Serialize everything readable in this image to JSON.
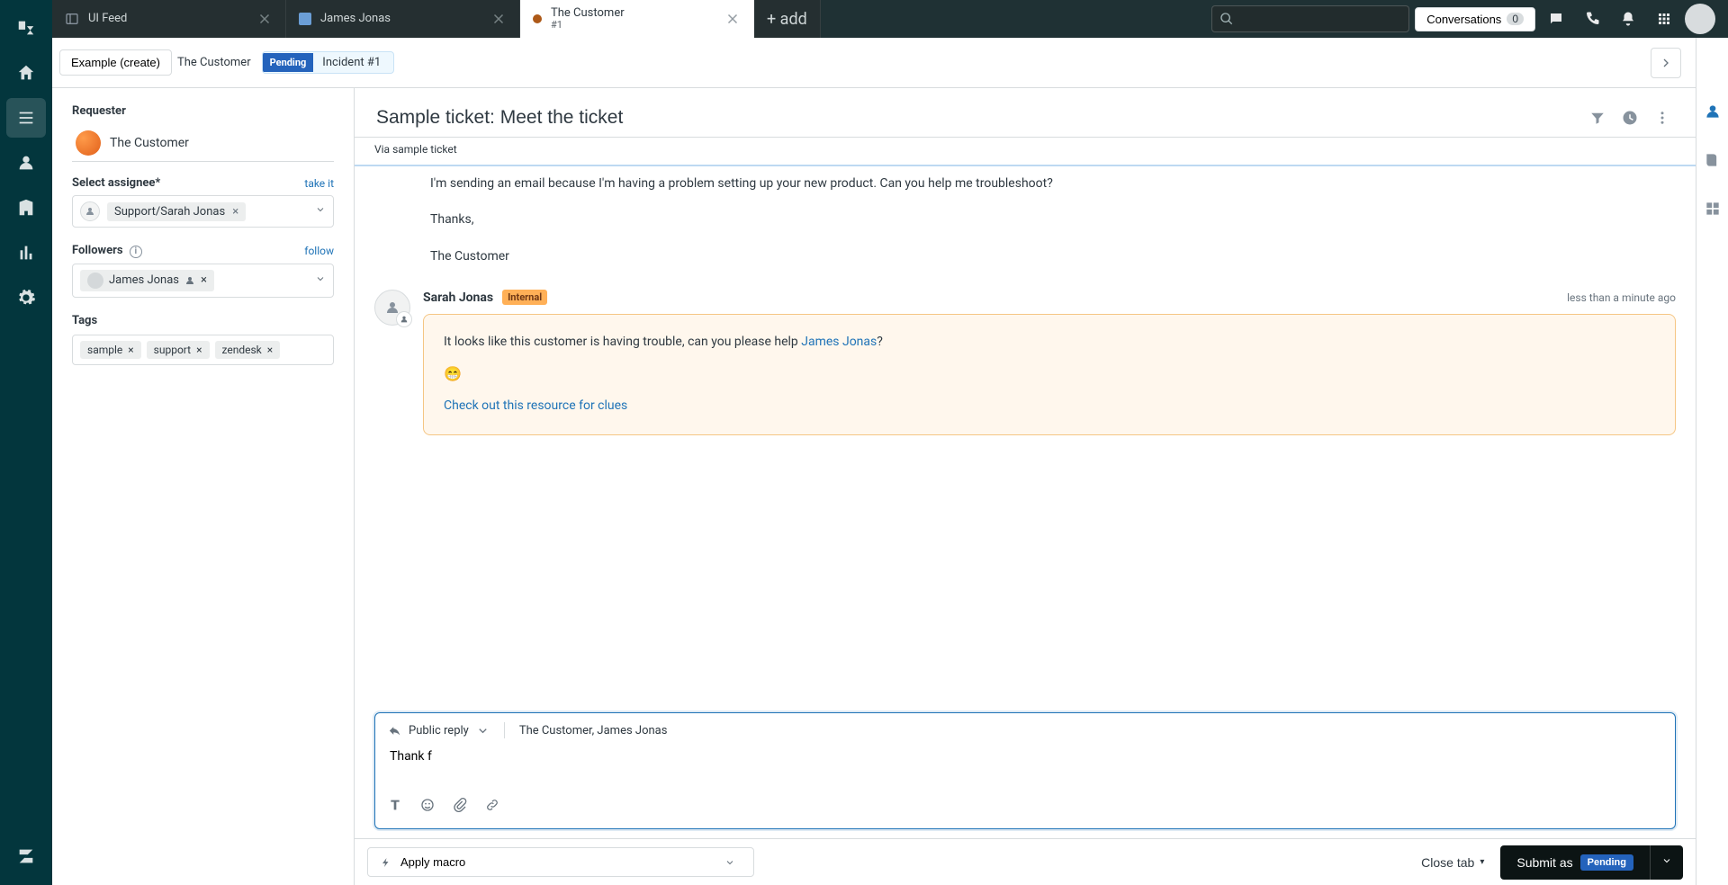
{
  "product_rail": [
    {
      "id": "home",
      "active": false
    },
    {
      "id": "dashboard",
      "active": true
    },
    {
      "id": "views",
      "active": false
    },
    {
      "id": "customers",
      "active": false
    },
    {
      "id": "organizations",
      "active": false
    },
    {
      "id": "reporting",
      "active": false
    },
    {
      "id": "admin",
      "active": false
    }
  ],
  "tabs": {
    "items": [
      {
        "title": "UI Feed",
        "icon": "panel",
        "active": false
      },
      {
        "title": "James Jonas",
        "icon": "user",
        "active": false
      },
      {
        "title": "The Customer",
        "subtitle": "#1",
        "icon": "dot",
        "active": true
      }
    ],
    "add_label": "+ add"
  },
  "conversations_btn": {
    "label": "Conversations",
    "count": "0"
  },
  "secondary": {
    "crumb1": "Example (create)",
    "crumb2": "The Customer",
    "status_pill_label": "Pending",
    "status_label": "Incident #1"
  },
  "left": {
    "requester_label": "Requester",
    "requester_name": "The Customer",
    "assignee_label": "Select assignee*",
    "assignee_value": "Support/Sarah Jonas",
    "take_it": "take it",
    "followers_label": "Followers",
    "followers_value": "James Jonas",
    "follow_link": "follow",
    "tags_label": "Tags",
    "tags": [
      "sample",
      "support",
      "zendesk"
    ]
  },
  "main": {
    "subject": "Sample ticket: Meet the ticket",
    "via": "Via sample ticket",
    "convo_p1": "I'm sending an email because I'm having a problem setting up your new product. Can you help me troubleshoot?",
    "convo_p2": "Thanks,",
    "convo_p3": "The Customer",
    "note_author": "Sarah Jonas",
    "note_badge": "Internal",
    "note_time": "less than a minute ago",
    "note_line1_pre": "It looks like this customer is having trouble, can you please help ",
    "note_line1_mention": "James Jonas",
    "note_line1_post": "?",
    "note_emoji": "😁",
    "note_link": "Check out this resource for clues"
  },
  "reply": {
    "mode": "Public reply",
    "recipients": "The Customer, James Jonas",
    "draft": "Thank f"
  },
  "bottom": {
    "macro_prefix": "Apply macro",
    "close_tab": "Close tab",
    "submit_prefix": "Submit as",
    "submit_status": "Pending"
  },
  "accent_colors": {
    "status_blue": "#2463bc",
    "note_yellow": "#fff7ed"
  }
}
